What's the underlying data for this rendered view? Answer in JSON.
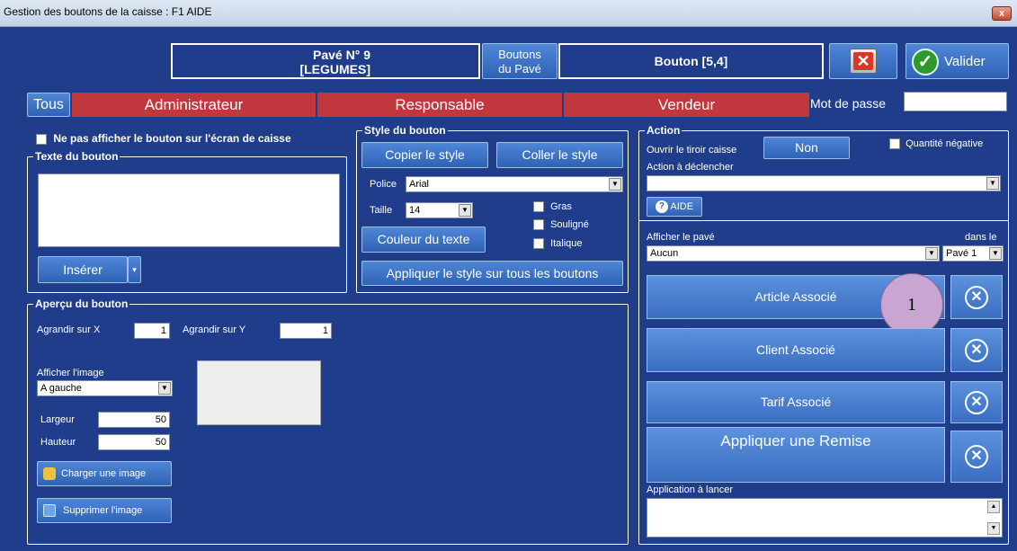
{
  "window": {
    "title": "Gestion des boutons de la caisse : F1 AIDE",
    "close": "x"
  },
  "header": {
    "pave_line1": "Pavé N° 9",
    "pave_line2": "[LEGUMES]",
    "boutons_pave_line1": "Boutons",
    "boutons_pave_line2": "du Pavé",
    "bouton": "Bouton [5,4]",
    "valider": "Valider"
  },
  "roles": {
    "tous": "Tous",
    "admin": "Administrateur",
    "resp": "Responsable",
    "vendeur": "Vendeur",
    "mot_de_passe": "Mot de passe",
    "mot_de_passe_value": ""
  },
  "texte": {
    "hide_label": "Ne pas afficher le bouton sur l'écran de caisse",
    "group_title": "Texte du bouton",
    "inserer": "Insérer"
  },
  "style": {
    "group_title": "Style du bouton",
    "copier": "Copier le style",
    "coller": "Coller le style",
    "police_label": "Police",
    "police_value": "Arial",
    "taille_label": "Taille",
    "taille_value": "14",
    "gras": "Gras",
    "souligne": "Souligné",
    "italique": "Italique",
    "couleur": "Couleur du texte",
    "appliquer": "Appliquer le style sur tous les boutons"
  },
  "apercu": {
    "group_title": "Aperçu du bouton",
    "agrandir_x": "Agrandir sur X",
    "agrandir_x_value": "1",
    "agrandir_y": "Agrandir sur Y",
    "agrandir_y_value": "1",
    "afficher_image": "Afficher l'image",
    "position_value": "A gauche",
    "largeur": "Largeur",
    "largeur_value": "50",
    "hauteur": "Hauteur",
    "hauteur_value": "50",
    "charger": "Charger une image",
    "supprimer": "Supprimer l'image"
  },
  "action": {
    "group_title": "Action",
    "ouvrir_tiroir": "Ouvrir le tiroir caisse",
    "non": "Non",
    "quantite_negative": "Quantité négative",
    "action_declencher": "Action à déclencher",
    "action_value": "",
    "aide": "AIDE",
    "afficher_pave": "Afficher le pavé",
    "dans_le": "dans le",
    "pave_value": "Aucun",
    "dans_value": "Pavé 1",
    "article": "Article Associé",
    "client": "Client Associé",
    "tarif": "Tarif Associé",
    "remise": "Appliquer une Remise",
    "application": "Application à lancer",
    "callout": "1"
  }
}
